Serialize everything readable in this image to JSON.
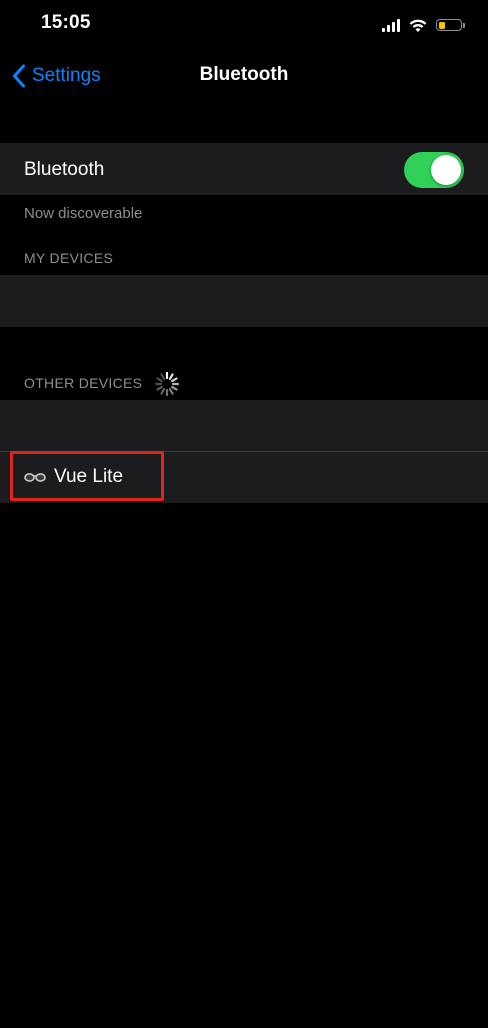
{
  "status_bar": {
    "time": "15:05",
    "battery_level": 0.3,
    "battery_color": "#f7c500",
    "icons": [
      "cellular-signal-icon",
      "wifi-icon",
      "battery-icon"
    ]
  },
  "nav": {
    "back_label": "Settings",
    "back_icon": "chevron-left-icon",
    "title": "Bluetooth"
  },
  "bluetooth_toggle": {
    "label": "Bluetooth",
    "on": true,
    "on_color": "#30d158"
  },
  "discoverable_text": "Now discoverable",
  "my_devices": {
    "header": "MY DEVICES",
    "items": []
  },
  "other_devices": {
    "header": "OTHER DEVICES",
    "loading_icon": "spinner-icon",
    "items": [
      {
        "icon": "glasses-icon",
        "name": "Vue Lite"
      }
    ]
  },
  "colors": {
    "background": "#000000",
    "cell": "#1c1c1e",
    "accent": "#0a84ff",
    "secondary_text": "#8e8e93",
    "highlight": "#e0261c"
  }
}
